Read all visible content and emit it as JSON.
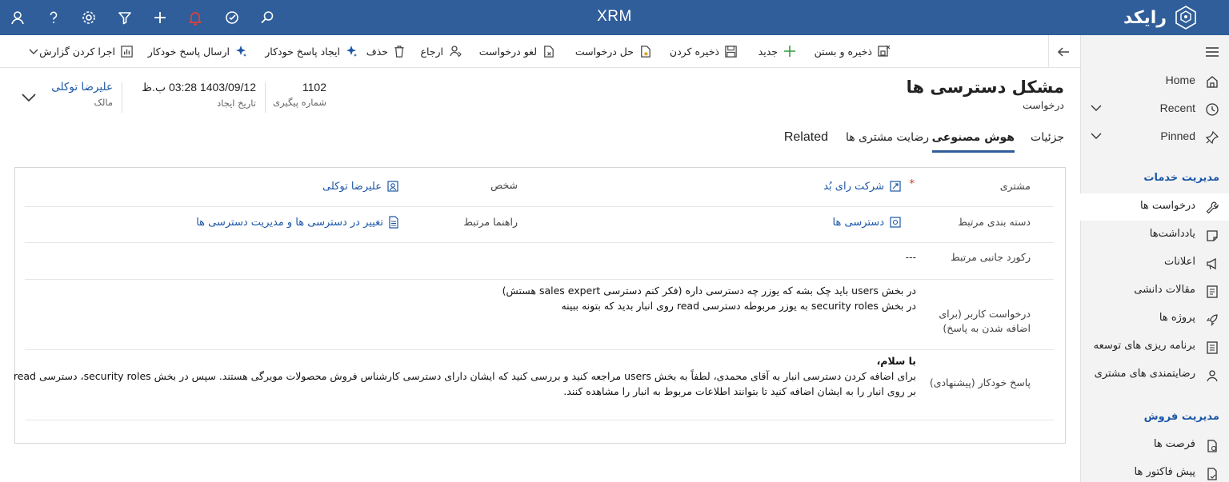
{
  "app": {
    "title": "XRM",
    "logo_text": "رایکد"
  },
  "command_bar": {
    "save_close": "ذخیره و بستن",
    "new": "جدید",
    "save": "ذخیره کردن",
    "resolve": "حل درخواست",
    "cancel": "لغو درخواست",
    "assign": "ارجاع",
    "delete": "حذف",
    "create_auto_reply": "ایجاد پاسخ خودکار",
    "send_auto_reply": "ارسال پاسخ خودکار",
    "run_report": "اجرا کردن گزارش"
  },
  "record": {
    "title": "مشکل دسترسی ها",
    "entity": "درخواست",
    "tracking_number": "1102",
    "tracking_number_label": "شماره پیگیری",
    "created_on": "1403/09/12 03:28 ب.ظ",
    "created_on_label": "تاریخ ایجاد",
    "owner": "علیرضا توکلی",
    "owner_label": "مالک"
  },
  "tabs": [
    {
      "label": "جزئیات"
    },
    {
      "label": "هوش مصنوعی"
    },
    {
      "label": "رضایت مشتری ها"
    },
    {
      "label": "Related"
    }
  ],
  "form": {
    "customer_label": "مشتری",
    "customer_value": "شرکت رای بُد",
    "person_label": "شخص",
    "person_value": "علیرضا توکلی",
    "category_label": "دسته بندی مرتبط",
    "category_value": "دسترسی ها",
    "guide_label": "راهنما مرتبط",
    "guide_value": "تغییر در دسترسی ها و مدیریت دسترسی ها",
    "side_record_label": "رکورد جانبی مرتبط",
    "side_record_value": "---",
    "user_request_label_1": "درخواست کاربر (برای",
    "user_request_label_2": "اضافه شدن به پاسخ)",
    "user_request_line_1": "در بخش users باید چک بشه که یوزر چه دسترسی داره (فکر کنم دسترسی sales expert هستش)",
    "user_request_line_2": "در بخش security roles به یوزر مربوطه دسترسی read روی انبار بدید که بتونه ببینه",
    "auto_reply_label": "پاسخ خودکار (پیشنهادی)",
    "auto_reply_line_1": "با سلام،",
    "auto_reply_line_2": "برای اضافه کردن دسترسی انبار به آقای محمدی، لطفاً به بخش users مراجعه کنید و بررسی کنید که ایشان دارای دسترسی کارشناس فروش محصولات مویرگی هستند. سپس در بخش security roles، دسترسی read",
    "auto_reply_line_3": "بر روی انبار را به ایشان اضافه کنید تا بتوانند اطلاعات مربوط به انبار را مشاهده کنند."
  },
  "sitemap": {
    "home": "Home",
    "recent": "Recent",
    "pinned": "Pinned",
    "group_services": "مدیریت خدمات",
    "items_services": [
      {
        "label": "درخواست ها"
      },
      {
        "label": "یادداشت‌ها"
      },
      {
        "label": "اعلانات"
      },
      {
        "label": "مقالات دانشی"
      },
      {
        "label": "پروژه ها"
      },
      {
        "label": "برنامه ریزی های توسعه"
      },
      {
        "label": "رضایتمندی های مشتری"
      }
    ],
    "group_sales": "مدیریت فروش",
    "items_sales": [
      {
        "label": "فرصت ها"
      },
      {
        "label": "پیش فاکتور ها"
      }
    ]
  }
}
